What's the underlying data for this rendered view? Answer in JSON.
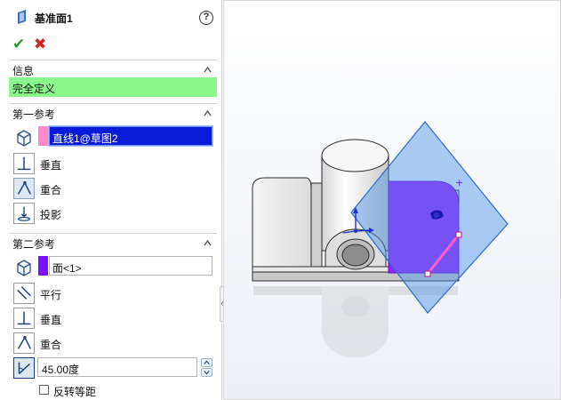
{
  "panel": {
    "title": "基准面1",
    "help": "?",
    "ok": "✔",
    "cancel": "✖"
  },
  "sections": {
    "info": {
      "title": "信息",
      "status": "完全定义",
      "status_color": "#8cf78c"
    },
    "first_ref": {
      "title": "第一参考",
      "selection": "直线1@草图2",
      "chip_color": "#ff88cc",
      "options": [
        "垂直",
        "重合",
        "投影"
      ],
      "active_option": "重合"
    },
    "second_ref": {
      "title": "第二参考",
      "selection": "面<1>",
      "chip_color": "#7a10ff",
      "options": [
        "平行",
        "垂直",
        "重合"
      ],
      "angle": "45.00度",
      "flip_label": "反转等距"
    }
  },
  "viewport": {
    "plane_color": "#4a90e8",
    "face_color": "#9b20ff",
    "line_color": "#ff5cc8"
  }
}
